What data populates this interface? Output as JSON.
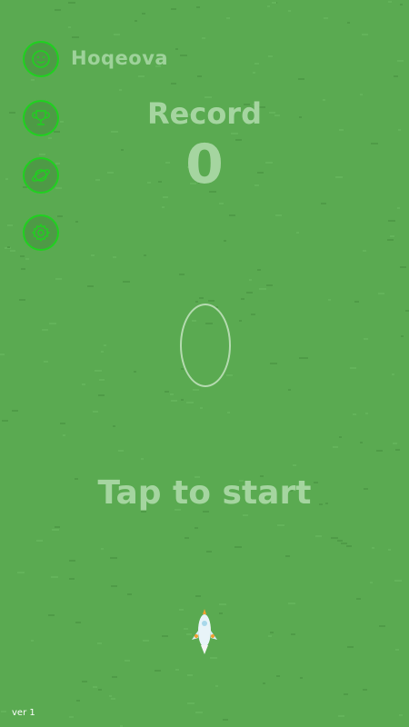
{
  "player": {
    "name": "Hoqeova",
    "avatar_icon": "smiley-icon"
  },
  "menu": {
    "items": [
      {
        "name": "leaderboard",
        "icon": "trophy-icon"
      },
      {
        "name": "worlds",
        "icon": "planet-icon"
      },
      {
        "name": "settings",
        "icon": "gear-icon"
      }
    ]
  },
  "record": {
    "label": "Record",
    "value": "0"
  },
  "prompt": {
    "text": "Tap to start"
  },
  "version": "ver 1",
  "colors": {
    "background": "#5aaa51",
    "accent_ring": "#1fd11f",
    "text": "#a5d5a0"
  }
}
